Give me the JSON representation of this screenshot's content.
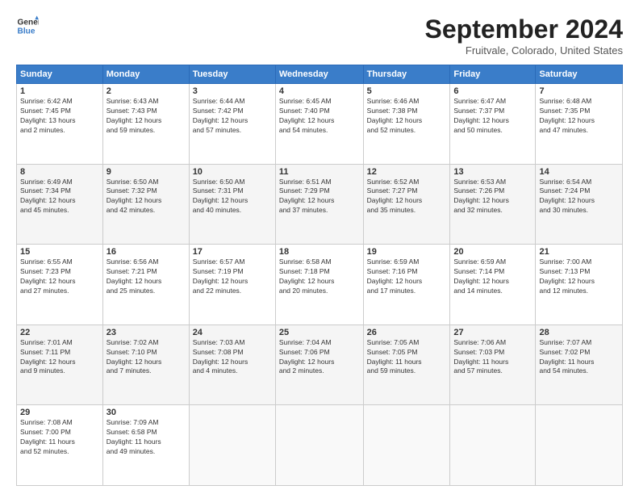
{
  "header": {
    "logo_line1": "General",
    "logo_line2": "Blue",
    "month": "September 2024",
    "location": "Fruitvale, Colorado, United States"
  },
  "columns": [
    "Sunday",
    "Monday",
    "Tuesday",
    "Wednesday",
    "Thursday",
    "Friday",
    "Saturday"
  ],
  "weeks": [
    [
      {
        "day": "1",
        "info": "Sunrise: 6:42 AM\nSunset: 7:45 PM\nDaylight: 13 hours\nand 2 minutes."
      },
      {
        "day": "2",
        "info": "Sunrise: 6:43 AM\nSunset: 7:43 PM\nDaylight: 12 hours\nand 59 minutes."
      },
      {
        "day": "3",
        "info": "Sunrise: 6:44 AM\nSunset: 7:42 PM\nDaylight: 12 hours\nand 57 minutes."
      },
      {
        "day": "4",
        "info": "Sunrise: 6:45 AM\nSunset: 7:40 PM\nDaylight: 12 hours\nand 54 minutes."
      },
      {
        "day": "5",
        "info": "Sunrise: 6:46 AM\nSunset: 7:38 PM\nDaylight: 12 hours\nand 52 minutes."
      },
      {
        "day": "6",
        "info": "Sunrise: 6:47 AM\nSunset: 7:37 PM\nDaylight: 12 hours\nand 50 minutes."
      },
      {
        "day": "7",
        "info": "Sunrise: 6:48 AM\nSunset: 7:35 PM\nDaylight: 12 hours\nand 47 minutes."
      }
    ],
    [
      {
        "day": "8",
        "info": "Sunrise: 6:49 AM\nSunset: 7:34 PM\nDaylight: 12 hours\nand 45 minutes."
      },
      {
        "day": "9",
        "info": "Sunrise: 6:50 AM\nSunset: 7:32 PM\nDaylight: 12 hours\nand 42 minutes."
      },
      {
        "day": "10",
        "info": "Sunrise: 6:50 AM\nSunset: 7:31 PM\nDaylight: 12 hours\nand 40 minutes."
      },
      {
        "day": "11",
        "info": "Sunrise: 6:51 AM\nSunset: 7:29 PM\nDaylight: 12 hours\nand 37 minutes."
      },
      {
        "day": "12",
        "info": "Sunrise: 6:52 AM\nSunset: 7:27 PM\nDaylight: 12 hours\nand 35 minutes."
      },
      {
        "day": "13",
        "info": "Sunrise: 6:53 AM\nSunset: 7:26 PM\nDaylight: 12 hours\nand 32 minutes."
      },
      {
        "day": "14",
        "info": "Sunrise: 6:54 AM\nSunset: 7:24 PM\nDaylight: 12 hours\nand 30 minutes."
      }
    ],
    [
      {
        "day": "15",
        "info": "Sunrise: 6:55 AM\nSunset: 7:23 PM\nDaylight: 12 hours\nand 27 minutes."
      },
      {
        "day": "16",
        "info": "Sunrise: 6:56 AM\nSunset: 7:21 PM\nDaylight: 12 hours\nand 25 minutes."
      },
      {
        "day": "17",
        "info": "Sunrise: 6:57 AM\nSunset: 7:19 PM\nDaylight: 12 hours\nand 22 minutes."
      },
      {
        "day": "18",
        "info": "Sunrise: 6:58 AM\nSunset: 7:18 PM\nDaylight: 12 hours\nand 20 minutes."
      },
      {
        "day": "19",
        "info": "Sunrise: 6:59 AM\nSunset: 7:16 PM\nDaylight: 12 hours\nand 17 minutes."
      },
      {
        "day": "20",
        "info": "Sunrise: 6:59 AM\nSunset: 7:14 PM\nDaylight: 12 hours\nand 14 minutes."
      },
      {
        "day": "21",
        "info": "Sunrise: 7:00 AM\nSunset: 7:13 PM\nDaylight: 12 hours\nand 12 minutes."
      }
    ],
    [
      {
        "day": "22",
        "info": "Sunrise: 7:01 AM\nSunset: 7:11 PM\nDaylight: 12 hours\nand 9 minutes."
      },
      {
        "day": "23",
        "info": "Sunrise: 7:02 AM\nSunset: 7:10 PM\nDaylight: 12 hours\nand 7 minutes."
      },
      {
        "day": "24",
        "info": "Sunrise: 7:03 AM\nSunset: 7:08 PM\nDaylight: 12 hours\nand 4 minutes."
      },
      {
        "day": "25",
        "info": "Sunrise: 7:04 AM\nSunset: 7:06 PM\nDaylight: 12 hours\nand 2 minutes."
      },
      {
        "day": "26",
        "info": "Sunrise: 7:05 AM\nSunset: 7:05 PM\nDaylight: 11 hours\nand 59 minutes."
      },
      {
        "day": "27",
        "info": "Sunrise: 7:06 AM\nSunset: 7:03 PM\nDaylight: 11 hours\nand 57 minutes."
      },
      {
        "day": "28",
        "info": "Sunrise: 7:07 AM\nSunset: 7:02 PM\nDaylight: 11 hours\nand 54 minutes."
      }
    ],
    [
      {
        "day": "29",
        "info": "Sunrise: 7:08 AM\nSunset: 7:00 PM\nDaylight: 11 hours\nand 52 minutes."
      },
      {
        "day": "30",
        "info": "Sunrise: 7:09 AM\nSunset: 6:58 PM\nDaylight: 11 hours\nand 49 minutes."
      },
      {
        "day": "",
        "info": ""
      },
      {
        "day": "",
        "info": ""
      },
      {
        "day": "",
        "info": ""
      },
      {
        "day": "",
        "info": ""
      },
      {
        "day": "",
        "info": ""
      }
    ]
  ]
}
